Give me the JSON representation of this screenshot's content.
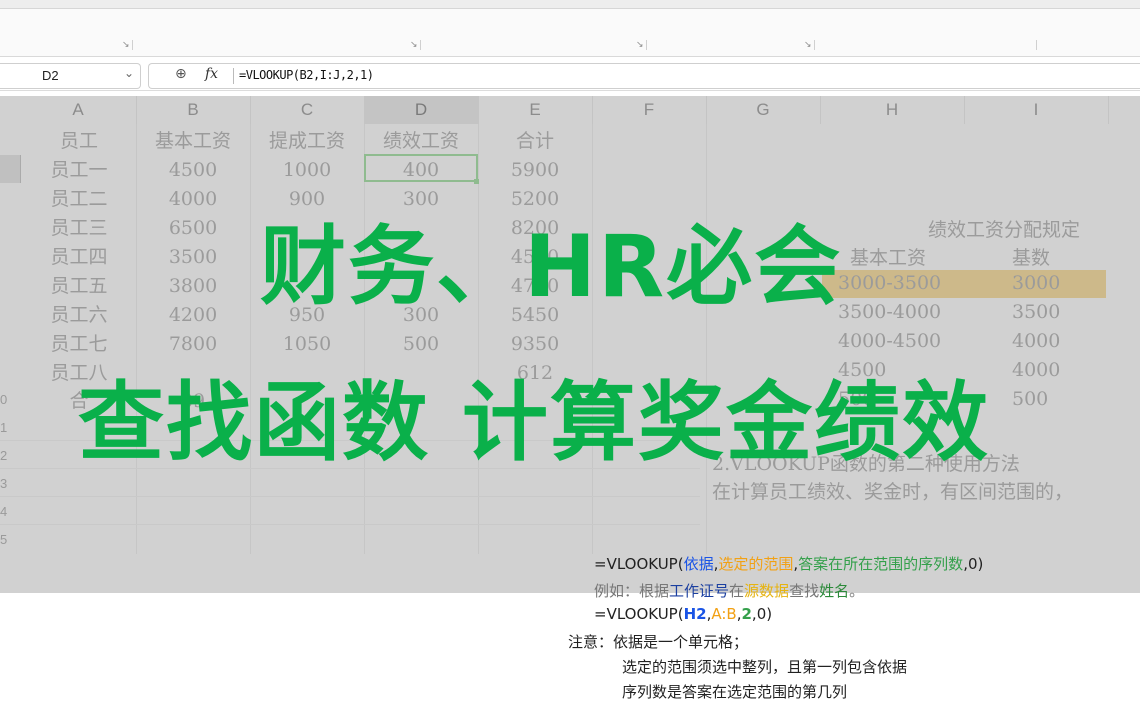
{
  "formula_bar": {
    "cell_ref": "D2",
    "formula": "=VLOOKUP(B2,I:J,2,1)"
  },
  "columns": [
    "A",
    "B",
    "C",
    "D",
    "E",
    "F",
    "G",
    "H",
    "I"
  ],
  "row_numbers": [
    "0",
    "1",
    "2",
    "3",
    "4",
    "5"
  ],
  "table": {
    "headers": [
      "员工",
      "基本工资",
      "提成工资",
      "绩效工资",
      "合计"
    ],
    "rows": [
      [
        "员工一",
        "4500",
        "1000",
        "400",
        "5900"
      ],
      [
        "员工二",
        "4000",
        "900",
        "300",
        "5200"
      ],
      [
        "员工三",
        "6500",
        "",
        "",
        "8200"
      ],
      [
        "员工四",
        "3500",
        "",
        "",
        "4590"
      ],
      [
        "员工五",
        "3800",
        "",
        "",
        "4760"
      ],
      [
        "员工六",
        "4200",
        "950",
        "300",
        "5450"
      ],
      [
        "员工七",
        "7800",
        "1050",
        "500",
        "9350"
      ],
      [
        "员工八",
        "",
        "",
        "",
        "612"
      ],
      [
        "合",
        "39",
        "",
        "",
        ""
      ]
    ]
  },
  "rules": {
    "title": "绩效工资分配规定",
    "col1": "基本工资",
    "col2": "基数",
    "rows": [
      [
        "3000-3500",
        "3000"
      ],
      [
        "3500-4000",
        "3500"
      ],
      [
        "4000-4500",
        "4000"
      ],
      [
        "4500",
        "4000"
      ],
      [
        "500",
        "500"
      ]
    ]
  },
  "method": {
    "line1": "2.VLOOKUP函数的第二种使用方法",
    "line2": "在计算员工绩效、奖金时，有区间范围的，"
  },
  "overlay": {
    "line1": "财务、HR必会",
    "line2": "查找函数 计算奖金绩效"
  },
  "notes": {
    "syntax": {
      "prefix": "=VLOOKUP(",
      "p1": "依据",
      "sep1": ",",
      "p2": "选定的范围",
      "sep2": ",",
      "p3": "答案在所在范围的序列数",
      "suffix": ",0)"
    },
    "example": {
      "t1": "例如：根据",
      "t2": "工作证号",
      "t3": "在",
      "t4": "源数据",
      "t5": "查找",
      "t6": "姓名",
      "t7": "。"
    },
    "example_formula": {
      "prefix": "=VLOOKUP(",
      "p1": "H2",
      "sep1": ",",
      "p2": "A:B",
      "sep2": ",",
      "p3": "2",
      "suffix": ",0)"
    },
    "attention_label": "注意：",
    "attention1": "依据是一个单元格；",
    "attention2": "选定的范围须选中整列，且第一列包含依据",
    "attention3": "序列数是答案在选定范围的第几列"
  },
  "colors": {
    "overlay_green": "#0ab04a",
    "highlight": "#cdb98a",
    "selection": "#8fbb8f"
  }
}
